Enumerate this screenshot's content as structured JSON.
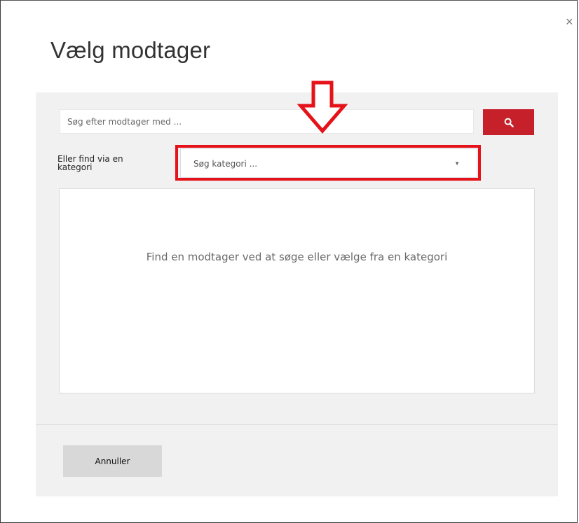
{
  "dialog": {
    "title": "Vælg modtager",
    "close_icon": "close-icon",
    "close_glyph": "×"
  },
  "search": {
    "placeholder": "Søg efter modtager med ...",
    "value": "",
    "button_icon": "search-icon",
    "button_color": "#c6202b"
  },
  "category": {
    "label": "Eller find via en kategori",
    "selected_value": "Søg kategori ...",
    "caret_icon": "chevron-down-icon",
    "caret_glyph": "▼"
  },
  "results": {
    "empty_message": "Find en modtager ved at søge eller vælge fra en kategori"
  },
  "footer": {
    "cancel_label": "Annuller"
  },
  "annotations": {
    "highlight_color": "#e5121a",
    "arrow_icon": "down-arrow-annotation"
  }
}
